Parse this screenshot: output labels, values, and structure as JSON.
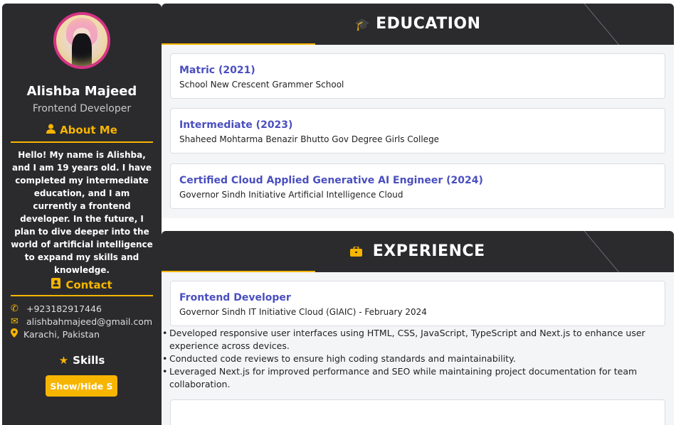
{
  "profile": {
    "name": "Alishba Majeed",
    "role": "Frontend Developer"
  },
  "about": {
    "heading": "About Me",
    "icon": "user-icon",
    "text": "Hello! My name is Alishba, and I am 19 years old. I have completed my intermediate education, and I am currently a frontend developer. In the future, I plan to dive deeper into the world of artificial intelligence to expand my skills and knowledge."
  },
  "contact": {
    "heading": "Contact",
    "icon": "address-book-icon",
    "phone": "+923182917446",
    "email": "alishbahmajeed@gmail.com",
    "location": "Karachi, Pakistan"
  },
  "skills": {
    "heading": "Skills",
    "icon": "star-icon",
    "toggle_label": "Show/Hide S"
  },
  "education": {
    "heading": "EDUCATION",
    "icon": "graduation-cap-icon",
    "items": [
      {
        "title": "Matric (2021)",
        "subtitle": "School New Crescent Grammer School"
      },
      {
        "title": "Intermediate (2023)",
        "subtitle": "Shaheed Mohtarma Benazir Bhutto Gov Degree Girls College"
      },
      {
        "title": "Certified Cloud Applied Generative AI Engineer (2024)",
        "subtitle": "Governor Sindh Initiative Artificial Intelligence Cloud"
      }
    ]
  },
  "experience": {
    "heading": "EXPERIENCE",
    "icon": "briefcase-icon",
    "job": {
      "title": "Frontend Developer",
      "subtitle": "Governor Sindh IT Initiative Cloud (GIAIC) - February 2024"
    },
    "bullets": [
      "Developed responsive user interfaces using HTML, CSS, JavaScript, TypeScript and Next.js to enhance user experience across devices.",
      "Conducted code reviews to ensure high coding standards and maintainability.",
      "Leveraged Next.js for improved performance and SEO while maintaining project documentation for team collaboration."
    ]
  },
  "colors": {
    "accent": "#f7b500",
    "dark": "#2b2b2e",
    "link": "#4a4fbf",
    "avatar_border": "#d63384"
  }
}
